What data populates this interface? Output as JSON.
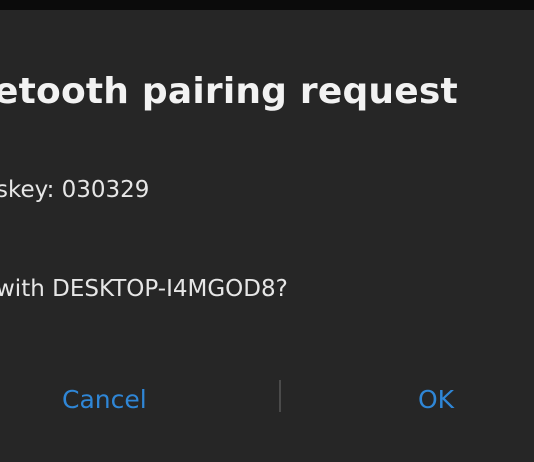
{
  "dialog": {
    "title": "etooth pairing request",
    "passkey_text": "skey: 030329",
    "question_text": "with DESKTOP-I4MGOD8?",
    "cancel_label": "Cancel",
    "ok_label": "OK"
  },
  "colors": {
    "dialog_bg": "#262626",
    "accent": "#2f86d6",
    "text": "#e6e6e6"
  }
}
